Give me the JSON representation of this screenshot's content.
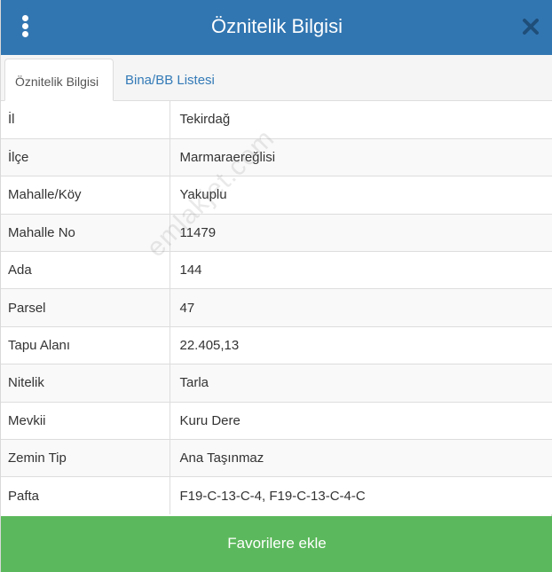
{
  "header": {
    "title": "Öznitelik Bilgisi",
    "menu_icon": "kebab-vertical-icon",
    "close_icon": "close-icon"
  },
  "tabs": [
    {
      "label": "Öznitelik Bilgisi",
      "active": true
    },
    {
      "label": "Bina/BB Listesi",
      "active": false
    }
  ],
  "attributes": [
    {
      "key": "İl",
      "value": "Tekirdağ"
    },
    {
      "key": "İlçe",
      "value": "Marmaraereğlisi"
    },
    {
      "key": "Mahalle/Köy",
      "value": "Yakuplu"
    },
    {
      "key": "Mahalle No",
      "value": "11479"
    },
    {
      "key": "Ada",
      "value": "144"
    },
    {
      "key": "Parsel",
      "value": "47"
    },
    {
      "key": "Tapu Alanı",
      "value": "22.405,13"
    },
    {
      "key": "Nitelik",
      "value": "Tarla"
    },
    {
      "key": "Mevkii",
      "value": "Kuru Dere"
    },
    {
      "key": "Zemin Tip",
      "value": "Ana Taşınmaz"
    },
    {
      "key": "Pafta",
      "value": "F19-C-13-C-4, F19-C-13-C-4-C"
    }
  ],
  "watermark": "emlakjet.com",
  "footer": {
    "favorite_label": "Favorilere ekle"
  },
  "colors": {
    "header_bg": "#3276b1",
    "footer_bg": "#5cb85c",
    "tab_link": "#337ab7"
  }
}
